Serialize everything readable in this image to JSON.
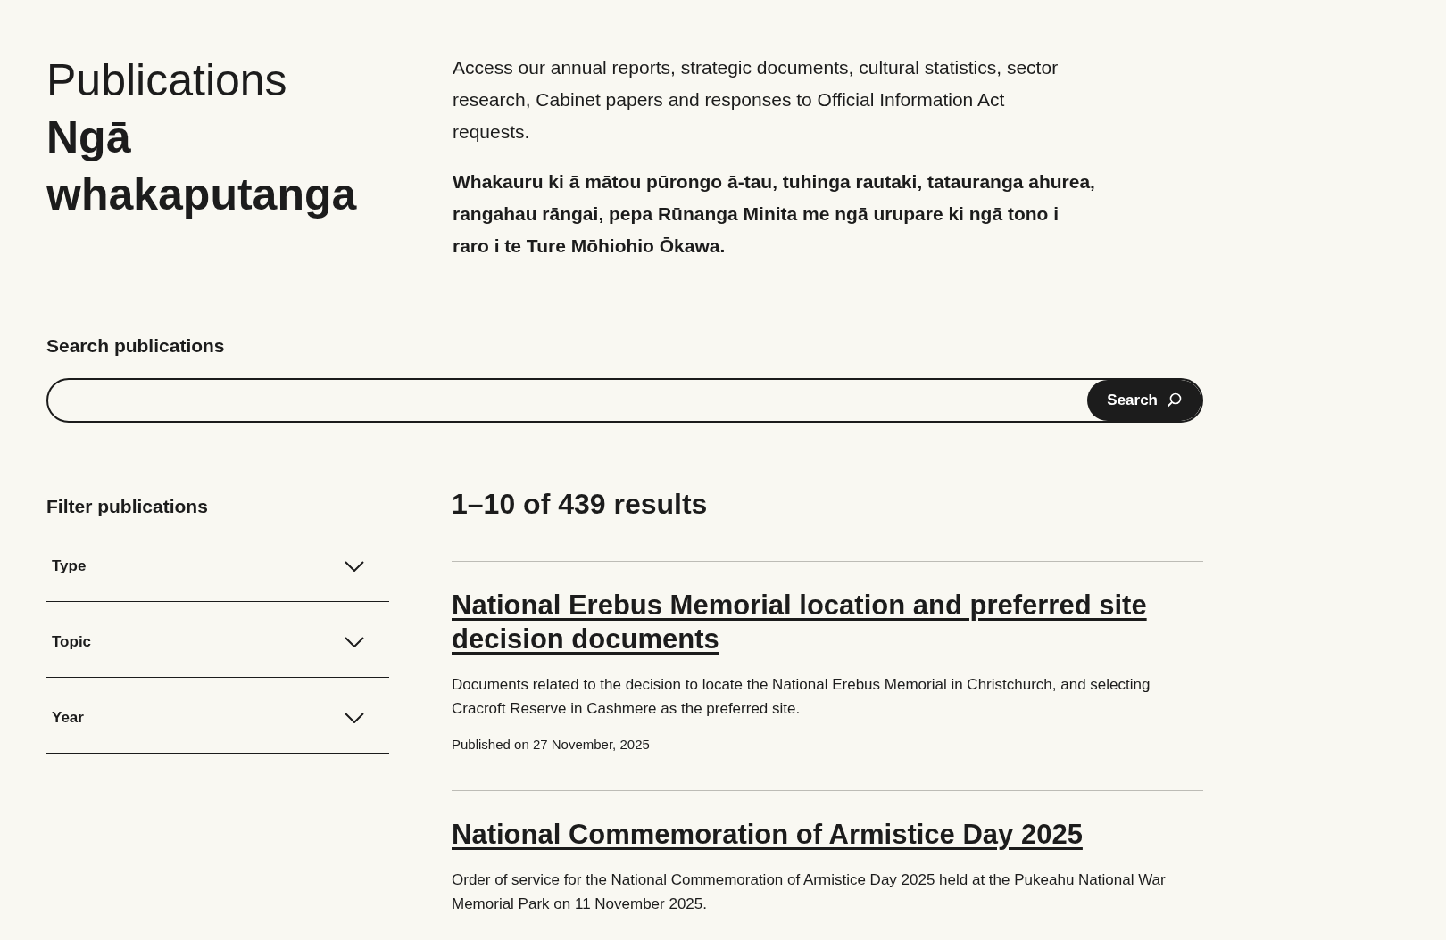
{
  "page": {
    "title": "Publications",
    "title_maori": "Ngā whakaputanga",
    "intro": "Access our annual reports, strategic documents, cultural statistics, sector research, Cabinet papers and responses to Official Information Act requests.",
    "intro_maori": "Whakauru ki ā mātou pūrongo ā-tau, tuhinga rautaki, tatauranga ahurea, rangahau rāngai, pepa Rūnanga Minita me ngā urupare ki ngā tono i raro i te Ture Mōhiohio Ōkawa."
  },
  "search": {
    "label": "Search publications",
    "button": "Search"
  },
  "filters": {
    "heading": "Filter publications",
    "items": [
      {
        "label": "Type",
        "expanded": false
      },
      {
        "label": "Topic",
        "expanded": false
      },
      {
        "label": "Year",
        "expanded": false
      }
    ]
  },
  "results": {
    "summary": "1–10 of 439 results",
    "items": [
      {
        "title": "National Erebus Memorial location and preferred site decision documents",
        "description": "Documents related to the decision to locate the National Erebus Memorial in Christchurch, and selecting Cracroft Reserve in Cashmere as the preferred site.",
        "published": "Published on 27 November, 2025"
      },
      {
        "title": "National Commemoration of Armistice Day 2025",
        "description": "Order of service for the National Commemoration of Armistice Day 2025 held at the Pukeahu National War Memorial Park on 11 November 2025."
      }
    ]
  }
}
